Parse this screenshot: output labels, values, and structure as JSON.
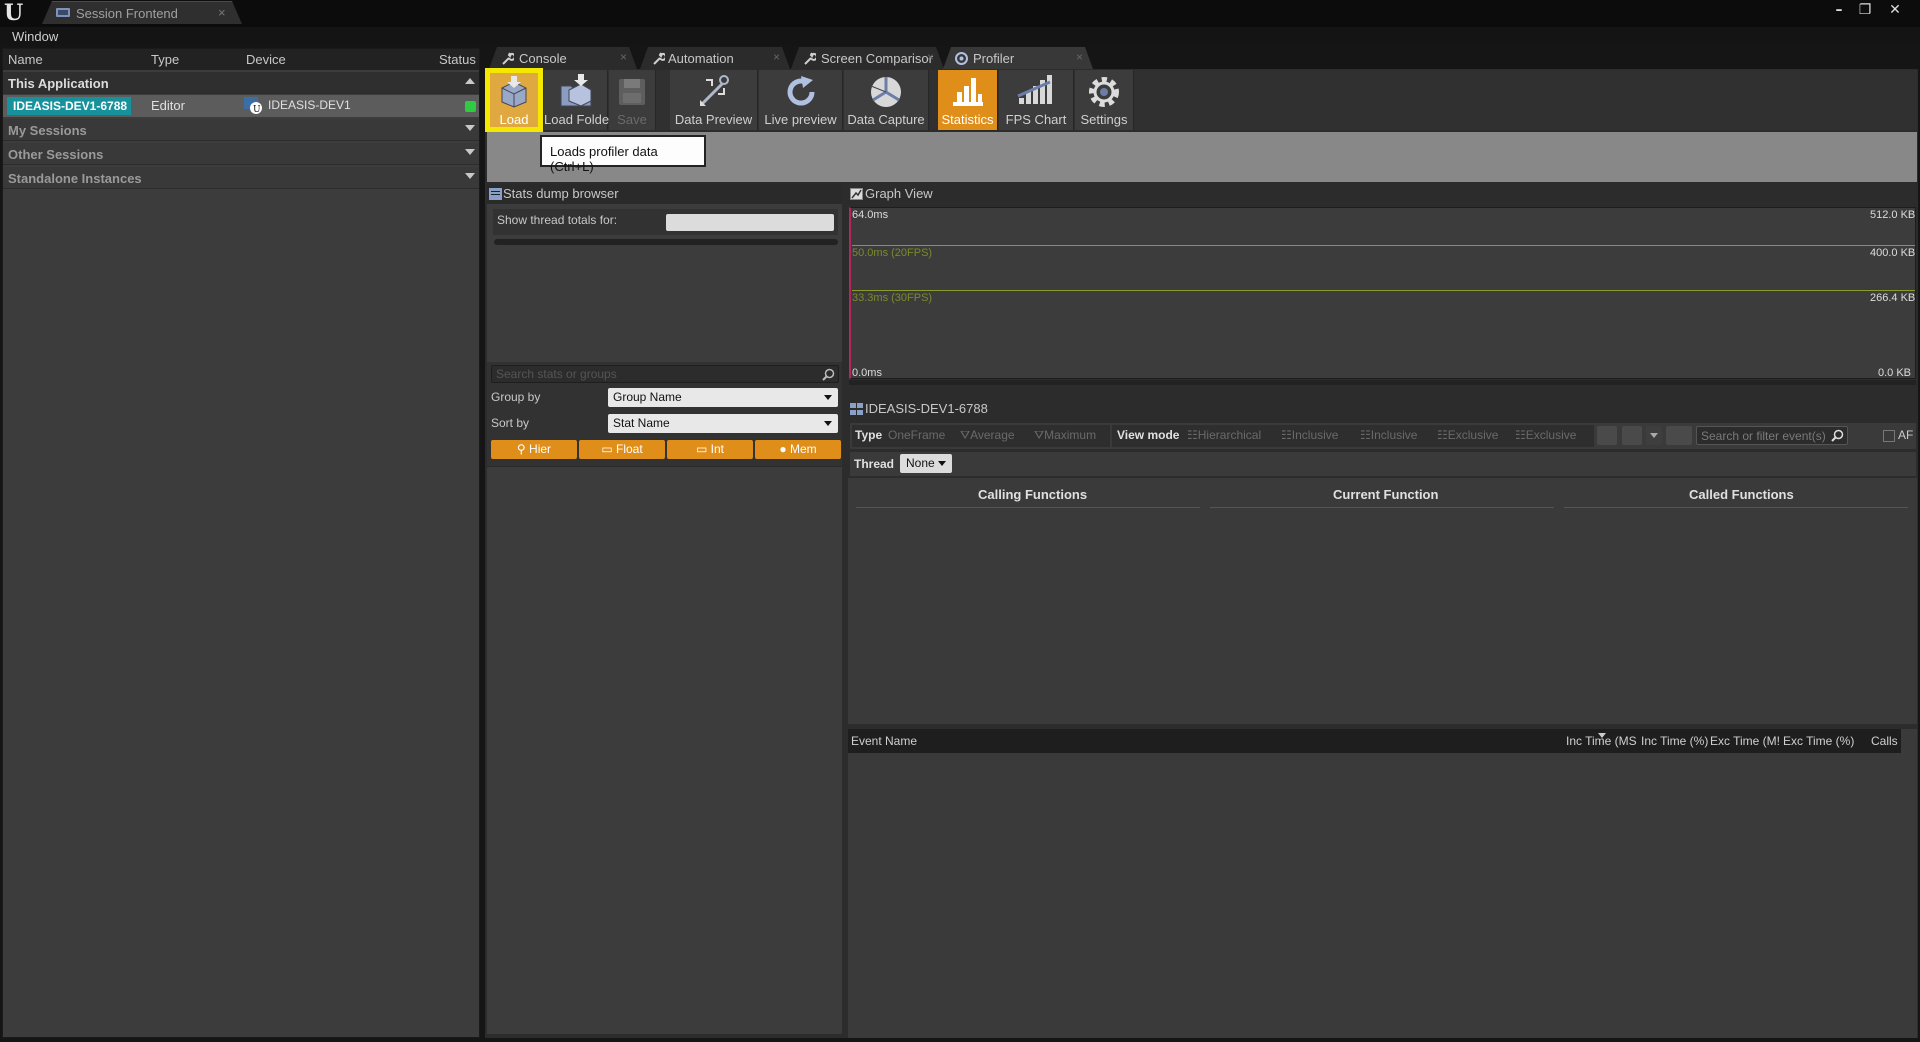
{
  "titlebar": {
    "tab_label": "Session Frontend",
    "tab_close": "×",
    "minimize": "–",
    "restore": "❐",
    "close": "✕"
  },
  "menu": {
    "window": "Window"
  },
  "sessions": {
    "columns": {
      "name": "Name",
      "type": "Type",
      "device": "Device",
      "status": "Status"
    },
    "groups": {
      "this_app": "This Application",
      "my_sessions": "My Sessions",
      "other_sessions": "Other Sessions",
      "standalone": "Standalone Instances"
    },
    "row": {
      "name": "IDEASIS-DEV1-6788",
      "type": "Editor",
      "device": "IDEASIS-DEV1",
      "status_color": "#2ecc40"
    }
  },
  "tabs": [
    {
      "label": "Console",
      "icon": "wrench-icon"
    },
    {
      "label": "Automation",
      "icon": "wrench-icon"
    },
    {
      "label": "Screen Comparisor",
      "icon": "wrench-icon"
    },
    {
      "label": "Profiler",
      "icon": "profiler-icon"
    }
  ],
  "toolbar": {
    "load": "Load",
    "load_folder": "Load Folder",
    "save": "Save",
    "data_preview": "Data Preview",
    "live_preview": "Live preview",
    "data_capture": "Data Capture",
    "statistics": "Statistics",
    "fps_chart": "FPS Chart",
    "settings": "Settings"
  },
  "tooltip": "Loads profiler data (Ctrl+L)",
  "stats_dump": {
    "title": "Stats dump browser",
    "show_thread_totals": "Show thread totals for:",
    "search_placeholder": "Search stats or groups",
    "group_by_label": "Group by",
    "group_by_value": "Group Name",
    "sort_by_label": "Sort by",
    "sort_by_value": "Stat Name",
    "buttons": {
      "hier": "Hier",
      "float": "Float",
      "int": "Int",
      "mem": "Mem"
    }
  },
  "graph_view": {
    "title": "Graph View",
    "left_labels": {
      "top": "64.0ms",
      "fps20": "50.0ms (20FPS)",
      "fps30": "33.3ms (30FPS)",
      "bottom": "0.0ms"
    },
    "right_labels": {
      "top": "512.0 KB",
      "fps20": "400.0 KB",
      "fps30": "266.4 KB",
      "bottom": "0.0 KB"
    },
    "accent_color": "#8b9a2a"
  },
  "thread_pane": {
    "title": "IDEASIS-DEV1-6788",
    "type_label": "Type",
    "one_frame": "OneFrame",
    "average": "Average",
    "maximum": "Maximum",
    "view_mode_label": "View mode",
    "hierarchical": "Hierarchical",
    "inclusive1": "Inclusive",
    "inclusive2": "Inclusive",
    "exclusive1": "Exclusive",
    "exclusive2": "Exclusive",
    "filter_placeholder": "Search or filter event(s)",
    "af": "AF",
    "thread_label": "Thread",
    "thread_value": "None",
    "calling": "Calling Functions",
    "current": "Current Function",
    "called": "Called Functions",
    "event_cols": {
      "name": "Event Name",
      "inc_ms": "Inc Time (MS",
      "inc_pct": "Inc Time (%)",
      "exc_ms": "Exc Time (M!",
      "exc_pct": "Exc Time (%)",
      "calls": "Calls"
    }
  }
}
